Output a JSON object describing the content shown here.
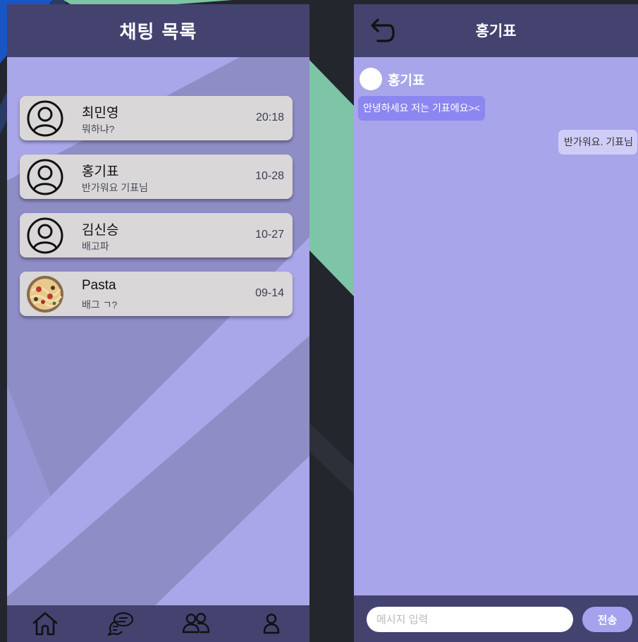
{
  "left_screen": {
    "header": {
      "title": "채팅 목록"
    },
    "chats": [
      {
        "name": "최민영",
        "preview": "뭐하냐?",
        "time": "20:18",
        "avatar": "user-outline-icon"
      },
      {
        "name": "홍기표",
        "preview": "반가워요 기표님",
        "time": "10-28",
        "avatar": "user-outline-icon"
      },
      {
        "name": "김신승",
        "preview": "배고파",
        "time": "10-27",
        "avatar": "user-outline-icon"
      },
      {
        "name": "Pasta",
        "preview": "배그 ㄱ?",
        "time": "09-14",
        "avatar": "pasta-photo"
      }
    ],
    "nav": [
      "home-icon",
      "chat-bubbles-icon",
      "friends-icon",
      "profile-icon"
    ]
  },
  "right_screen": {
    "header": {
      "title": "홍기표",
      "back_icon": "back-arrow-icon"
    },
    "sender_name": "홍기표",
    "messages": [
      {
        "direction": "incoming",
        "text": "안녕하세요 저는 기표에요><"
      },
      {
        "direction": "outgoing",
        "text": "반가워요. 기표님"
      }
    ],
    "input": {
      "placeholder": "메시지 입력",
      "value": ""
    },
    "send_label": "전송"
  },
  "colors": {
    "header": "#44426f",
    "screen_bg": "#a9a6e9",
    "list_item_bg": "#d9d7d7",
    "incoming_bubble": "#8c86f0",
    "outgoing_bubble": "#cfcdf7",
    "send_button": "#a6a2ed",
    "accent_green": "#7ec4a6",
    "accent_blue": "#1856c4"
  }
}
